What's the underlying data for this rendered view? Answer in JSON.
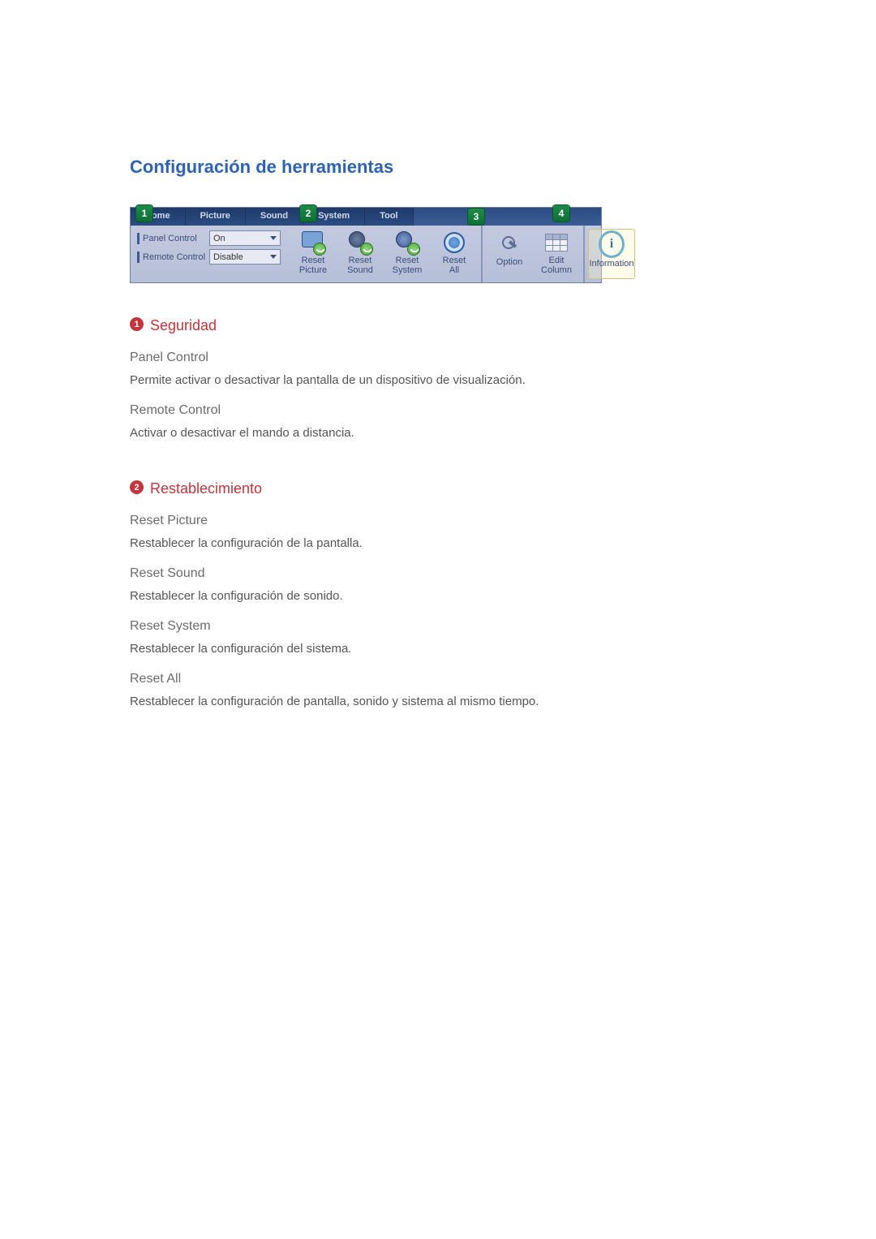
{
  "title": "Configuración de herramientas",
  "ribbon": {
    "tabs": [
      "Home",
      "Picture",
      "Sound",
      "System",
      "Tool"
    ],
    "panelControl": {
      "label": "Panel Control",
      "value": "On"
    },
    "remoteControl": {
      "label": "Remote Control",
      "value": "Disable"
    },
    "buttons": {
      "resetPicture": "Reset\nPicture",
      "resetSound": "Reset\nSound",
      "resetSystem": "Reset\nSystem",
      "resetAll": "Reset\nAll",
      "option": "Option",
      "editColumn": "Edit\nColumn",
      "information": "Information"
    }
  },
  "callouts": {
    "c1": "1",
    "c2": "2",
    "c3": "3",
    "c4": "4"
  },
  "sections": {
    "seguridad": {
      "num": "1",
      "title": "Seguridad",
      "items": [
        {
          "h": "Panel Control",
          "p": "Permite activar o desactivar la pantalla de un dispositivo de visualización."
        },
        {
          "h": "Remote Control",
          "p": "Activar o desactivar el mando a distancia."
        }
      ]
    },
    "restablecimiento": {
      "num": "2",
      "title": "Restablecimiento",
      "items": [
        {
          "h": "Reset Picture",
          "p": "Restablecer la configuración de la pantalla."
        },
        {
          "h": "Reset Sound",
          "p": "Restablecer la configuración de sonido."
        },
        {
          "h": "Reset System",
          "p": "Restablecer la configuración del sistema."
        },
        {
          "h": "Reset All",
          "p": "Restablecer la configuración de pantalla, sonido y sistema al mismo tiempo."
        }
      ]
    }
  }
}
